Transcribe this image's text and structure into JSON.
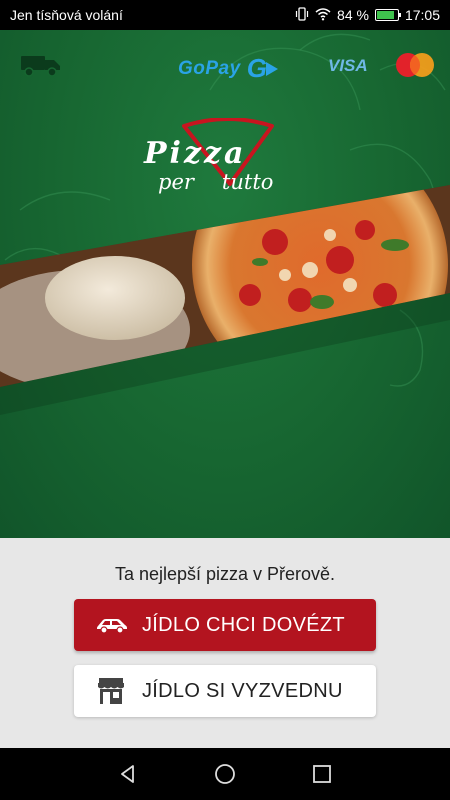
{
  "status_bar": {
    "carrier": "Jen tísňová volání",
    "battery_percent_text": "84 %",
    "battery_level": 0.84,
    "time": "17:05",
    "icons": [
      "vibrate-icon",
      "wifi-icon",
      "battery-icon"
    ]
  },
  "header": {
    "payment_icons": [
      "delivery-truck-icon",
      "gopay-logo",
      "visa-logo",
      "mastercard-logo"
    ],
    "gopay_label": "GoPay",
    "gopay_mark": "G",
    "visa_label": "VISA"
  },
  "logo": {
    "line1": "Pizza",
    "line2_left": "per",
    "line2_right": "tutto"
  },
  "colors": {
    "brand_green": "#176631",
    "brand_red": "#b3141f",
    "panel_bg": "#e7e7e7"
  },
  "bottom": {
    "tagline": "Ta nejlepší pizza v Přerově.",
    "delivery_button": "JÍDLO CHCI DOVÉZT",
    "pickup_button": "JÍDLO SI VYZVEDNU"
  },
  "nav": {
    "buttons": [
      "back-icon",
      "home-icon",
      "recents-icon"
    ]
  }
}
